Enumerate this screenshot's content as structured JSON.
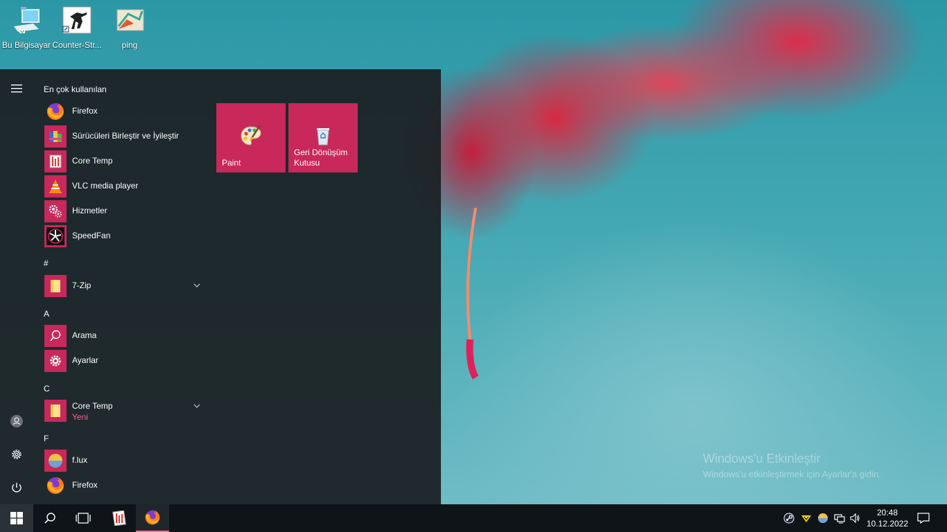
{
  "desktop": {
    "icons": [
      {
        "label": "Bu Bilgisayar",
        "icon": "computer-icon"
      },
      {
        "label": "Counter-Str...",
        "icon": "counter-strike-icon"
      },
      {
        "label": "ping",
        "icon": "ping-shortcut-icon"
      }
    ],
    "watermark": {
      "title": "Windows'u Etkinleştir",
      "subtitle": "Windows'u etkinleştirmek için Ayarlar'a gidin."
    }
  },
  "start_menu": {
    "most_used_header": "En çok kullanılan",
    "most_used": [
      {
        "label": "Firefox",
        "icon": "firefox-icon"
      },
      {
        "label": "Sürücüleri Birleştir ve İyileştir",
        "icon": "defrag-icon"
      },
      {
        "label": "Core Temp",
        "icon": "core-temp-icon"
      },
      {
        "label": "VLC media player",
        "icon": "vlc-icon"
      },
      {
        "label": "Hizmetler",
        "icon": "services-icon"
      },
      {
        "label": "SpeedFan",
        "icon": "speedfan-icon"
      }
    ],
    "sections": [
      {
        "letter": "#",
        "items": [
          {
            "label": "7-Zip",
            "icon": "folder-icon",
            "expandable": true
          }
        ]
      },
      {
        "letter": "A",
        "items": [
          {
            "label": "Arama",
            "icon": "search-icon"
          },
          {
            "label": "Ayarlar",
            "icon": "gear-icon"
          }
        ]
      },
      {
        "letter": "C",
        "items": [
          {
            "label": "Core Temp",
            "sub": "Yeni",
            "icon": "folder-icon",
            "expandable": true
          }
        ]
      },
      {
        "letter": "F",
        "items": [
          {
            "label": "f.lux",
            "icon": "flux-icon"
          },
          {
            "label": "Firefox",
            "icon": "firefox-icon"
          }
        ]
      }
    ],
    "tiles": [
      {
        "label": "Paint",
        "icon": "paint-palette-icon"
      },
      {
        "label": "Geri Dönüşüm Kutusu",
        "icon": "recycle-bin-icon"
      }
    ],
    "accent": "#c8285a"
  },
  "taskbar": {
    "time": "20:48",
    "date": "10.12.2022",
    "accent": "#ff6a9a"
  }
}
